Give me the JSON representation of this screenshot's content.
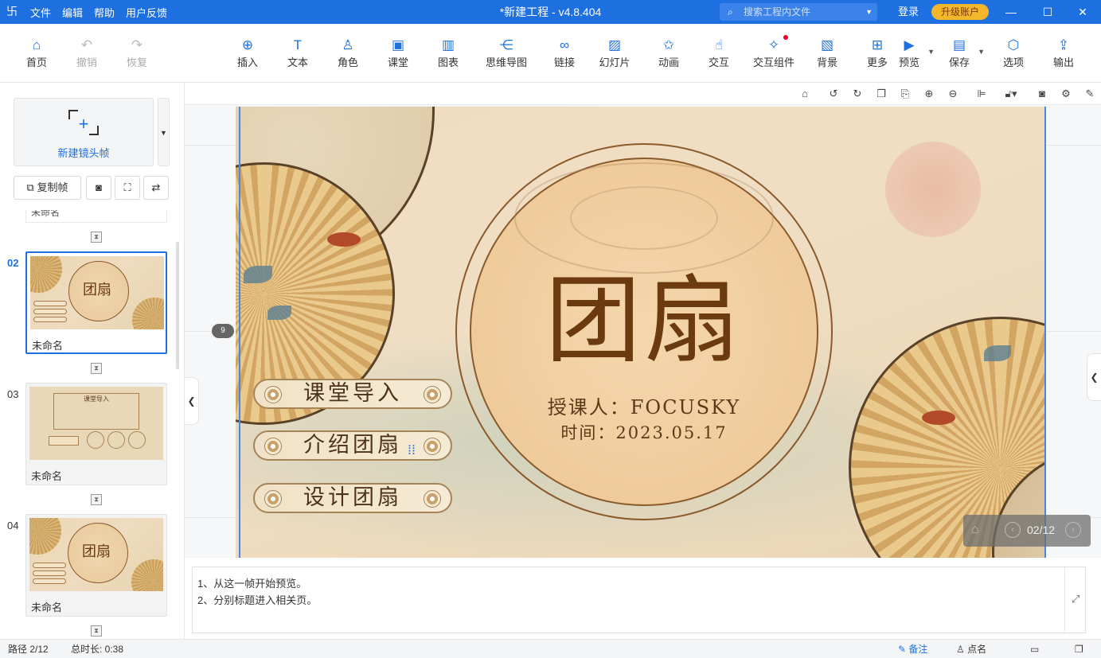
{
  "titlebar": {
    "app_icon": "logo-icon",
    "menu": [
      "文件",
      "编辑",
      "帮助",
      "用户反馈"
    ],
    "title": "*新建工程 - v4.8.404",
    "search_placeholder": "搜索工程内文件",
    "login": "登录",
    "upgrade": "升级账户"
  },
  "toolbar": {
    "home": "首页",
    "undo": "撤销",
    "redo": "恢复",
    "insert": "插入",
    "text": "文本",
    "role": "角色",
    "classroom": "课堂",
    "chart": "图表",
    "mindmap": "思维导图",
    "link": "链接",
    "slideshow": "幻灯片",
    "animation": "动画",
    "interaction": "交互",
    "interactive_widget": "交互组件",
    "background": "背景",
    "more": "更多",
    "preview": "预览",
    "save": "保存",
    "options": "选项",
    "export": "输出"
  },
  "left_panel": {
    "new_frame": "新建镜头帧",
    "copy_frame": "复制帧",
    "prev_stub": "未命名",
    "frames": [
      {
        "num": "02",
        "label": "未命名",
        "title": "团扇"
      },
      {
        "num": "03",
        "label": "未命名",
        "title": "课堂导入"
      },
      {
        "num": "04",
        "label": "未命名",
        "title": "团扇"
      }
    ]
  },
  "slide": {
    "title": "团扇",
    "teacher": "授课人：FOCUSKY",
    "date": "时间：2023.05.17",
    "nav_buttons": [
      "课堂导入",
      "介绍团扇",
      "设计团扇"
    ],
    "pager": "02/12",
    "badge": "9"
  },
  "notes": {
    "line1": "1、从这一帧开始预览。",
    "line2": "2、分别标题进入相关页。"
  },
  "statusbar": {
    "path": "路径 2/12",
    "duration": "总时长: 0:38",
    "notes_btn": "备注",
    "rollcall_btn": "点名"
  },
  "colors": {
    "accent": "#1e6fe0",
    "upgrade": "#f4b62a",
    "title_brown": "#6b3a0e"
  }
}
